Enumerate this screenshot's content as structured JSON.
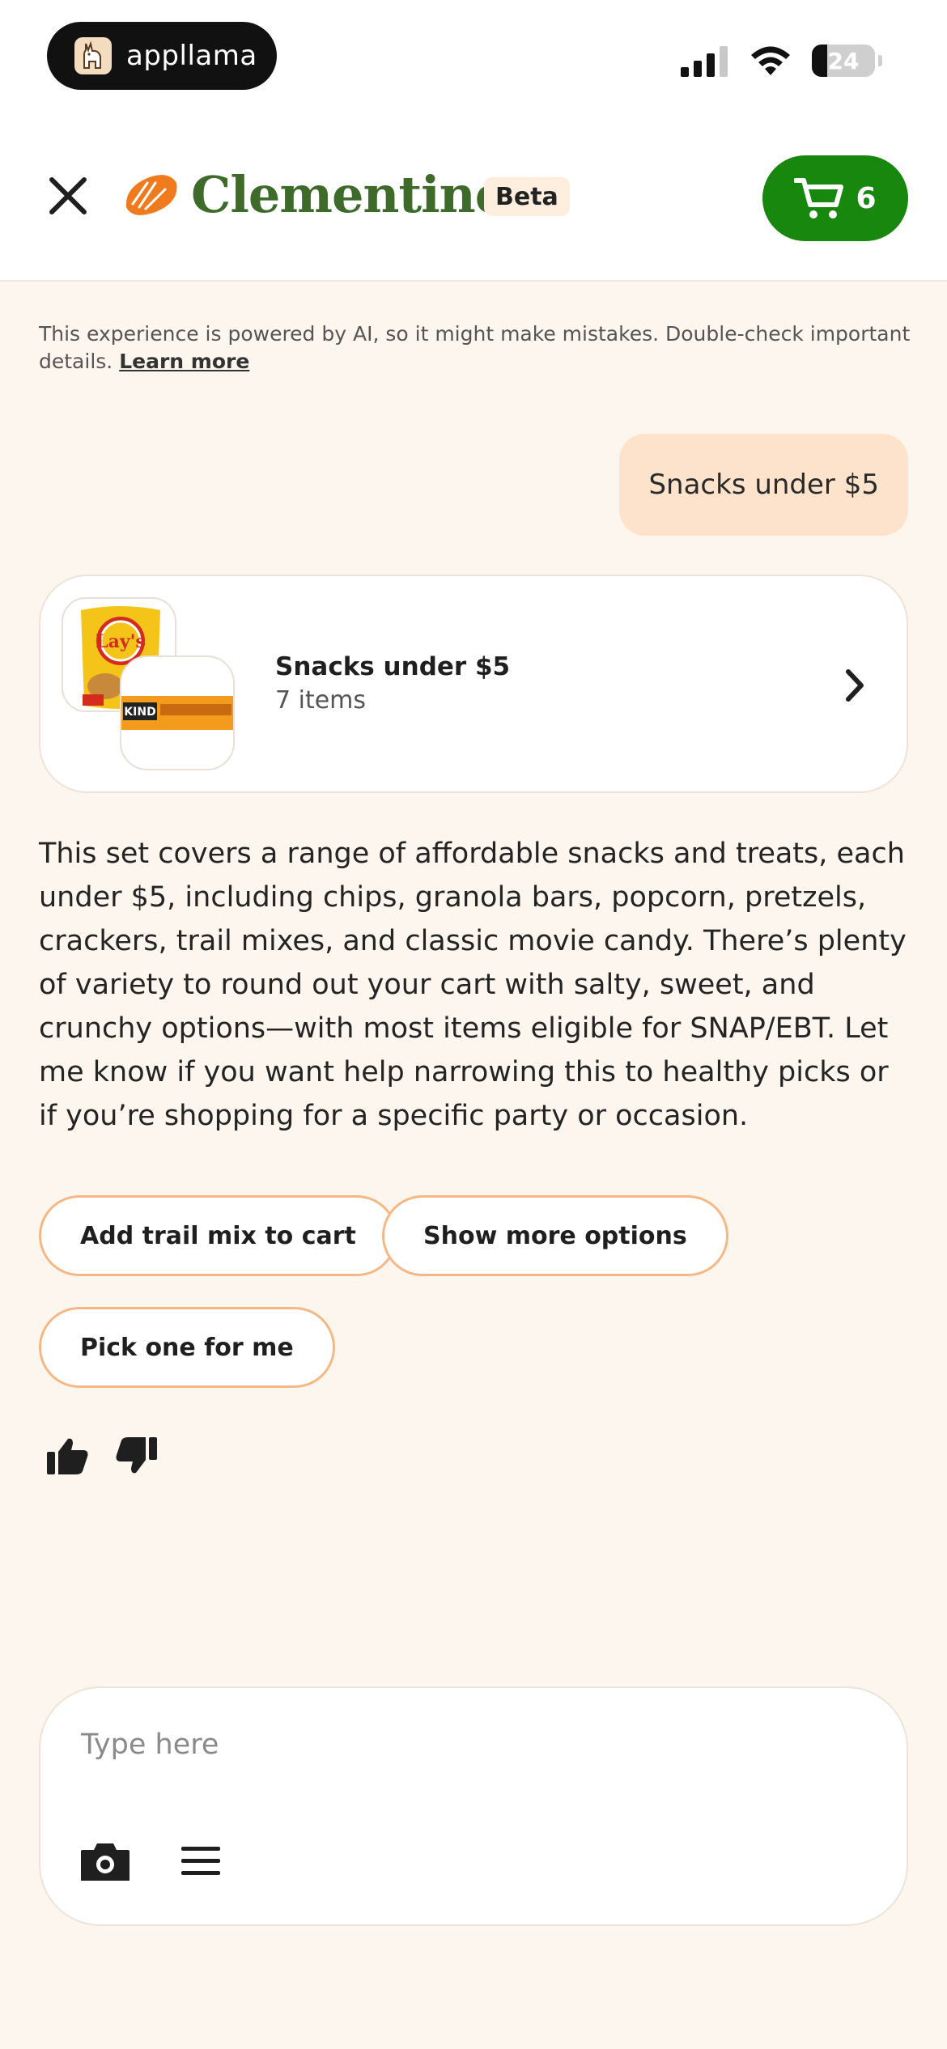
{
  "status_bar": {
    "app_pill_label": "appllama",
    "battery_level": "24"
  },
  "header": {
    "brand_name": "Clementine",
    "beta_label": "Beta",
    "cart_count": "6",
    "colors": {
      "brand_green": "#3e6b2a",
      "cart_green": "#17870e",
      "orange": "#f07a1e"
    }
  },
  "disclaimer": {
    "text": "This experience is powered by AI, so it might make mistakes. Double-check important details. ",
    "link": "Learn more"
  },
  "chat": {
    "user_message": "Snacks under $5",
    "collection_card": {
      "title": "Snacks under $5",
      "subtitle": "7 items",
      "thumb_1_brand": "Lay's",
      "thumb_2_brand": "KIND"
    },
    "reply": "This set covers a range of affordable snacks and treats, each under $5, including chips, granola bars, popcorn, pretzels, crackers, trail mixes, and classic movie candy. There’s plenty of variety to round out your cart with salty, sweet, and crunchy options—with most items eligible for SNAP/EBT. Let me know if you want help narrowing this to healthy picks or if you’re shopping for a specific party or occasion.",
    "suggestions": [
      "Add trail mix to cart",
      "Show more options",
      "Pick one for me"
    ]
  },
  "composer": {
    "placeholder": "Type here"
  },
  "icons": {
    "close": "close-icon",
    "cart": "cart-icon",
    "chevron": "chevron-right-icon",
    "thumbs_up": "thumbs-up-icon",
    "thumbs_down": "thumbs-down-icon",
    "camera": "camera-icon",
    "menu": "menu-icon"
  }
}
